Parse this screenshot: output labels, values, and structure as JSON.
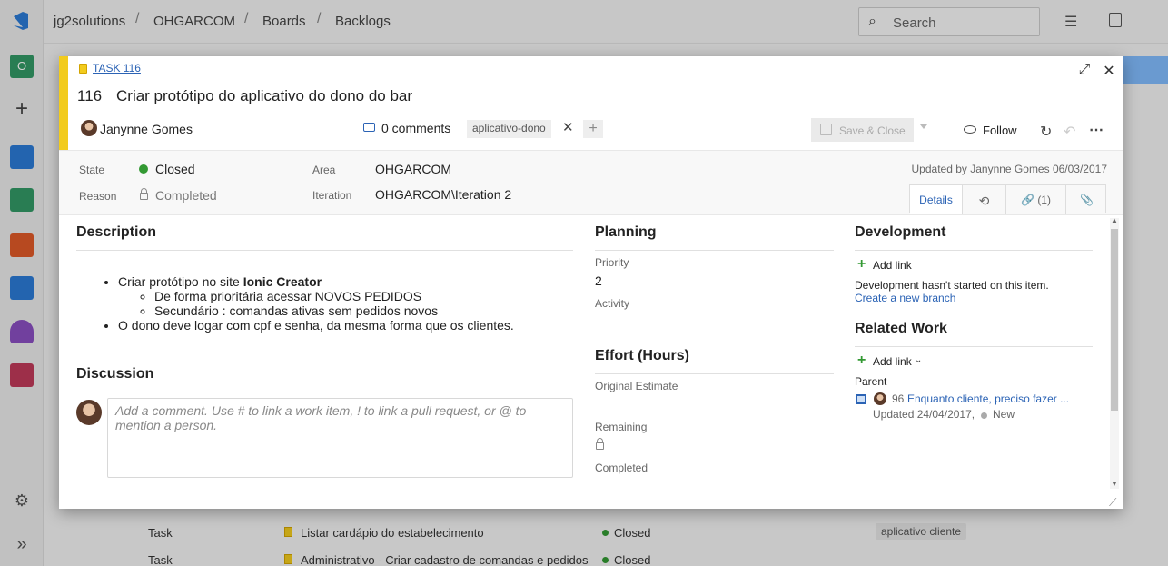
{
  "breadcrumbs": [
    "jg2solutions",
    "OHGARCOM",
    "Boards",
    "Backlogs"
  ],
  "search": {
    "placeholder": "Search"
  },
  "project_badge": "O",
  "background_rows": [
    {
      "type": "Task",
      "title": "Listar cardápio do estabelecimento",
      "state": "Closed",
      "tag": "aplicativo cliente"
    },
    {
      "type": "Task",
      "title": "Administrativo - Criar cadastro de comandas e pedidos",
      "state": "Closed",
      "tag": ""
    }
  ],
  "dialog": {
    "task_link": "TASK 116",
    "id": "116",
    "title": "Criar protótipo do aplicativo do dono do bar",
    "assignee": "Janynne Gomes",
    "comments": "0 comments",
    "tag": "aplicativo-dono",
    "save_close": "Save & Close",
    "follow": "Follow",
    "state_label": "State",
    "state_value": "Closed",
    "reason_label": "Reason",
    "reason_value": "Completed",
    "area_label": "Area",
    "area_value": "OHGARCOM",
    "iteration_label": "Iteration",
    "iteration_value": "OHGARCOM\\Iteration 2",
    "updated": "Updated by Janynne Gomes 06/03/2017",
    "tabs": {
      "details": "Details",
      "links": "(1)"
    },
    "description": {
      "heading": "Description",
      "item1_pre": "Criar protótipo no site ",
      "item1_bold": "Ionic Creator",
      "sub1": "De forma prioritária acessar NOVOS PEDIDOS",
      "sub2": "Secundário : comandas ativas sem pedidos novos",
      "item2": "O dono deve logar com cpf e senha, da mesma forma que os clientes."
    },
    "discussion": {
      "heading": "Discussion",
      "placeholder": "Add a comment. Use # to link a work item, ! to link a pull request, or @ to mention a person."
    },
    "planning": {
      "heading": "Planning",
      "priority_label": "Priority",
      "priority_value": "2",
      "activity_label": "Activity"
    },
    "effort": {
      "heading": "Effort (Hours)",
      "original_label": "Original Estimate",
      "remaining_label": "Remaining",
      "completed_label": "Completed"
    },
    "development": {
      "heading": "Development",
      "add_link": "Add link",
      "not_started": "Development hasn't started on this item.",
      "create_branch": "Create a new branch"
    },
    "related": {
      "heading": "Related Work",
      "add_link": "Add link",
      "parent_label": "Parent",
      "parent_id": "96",
      "parent_title": "Enquanto cliente, preciso fazer ...",
      "parent_updated": "Updated 24/04/2017,",
      "parent_state": "New"
    }
  },
  "colors": {
    "accent": "#f2cb1d",
    "link": "#2b63b5",
    "closed": "#339933"
  }
}
